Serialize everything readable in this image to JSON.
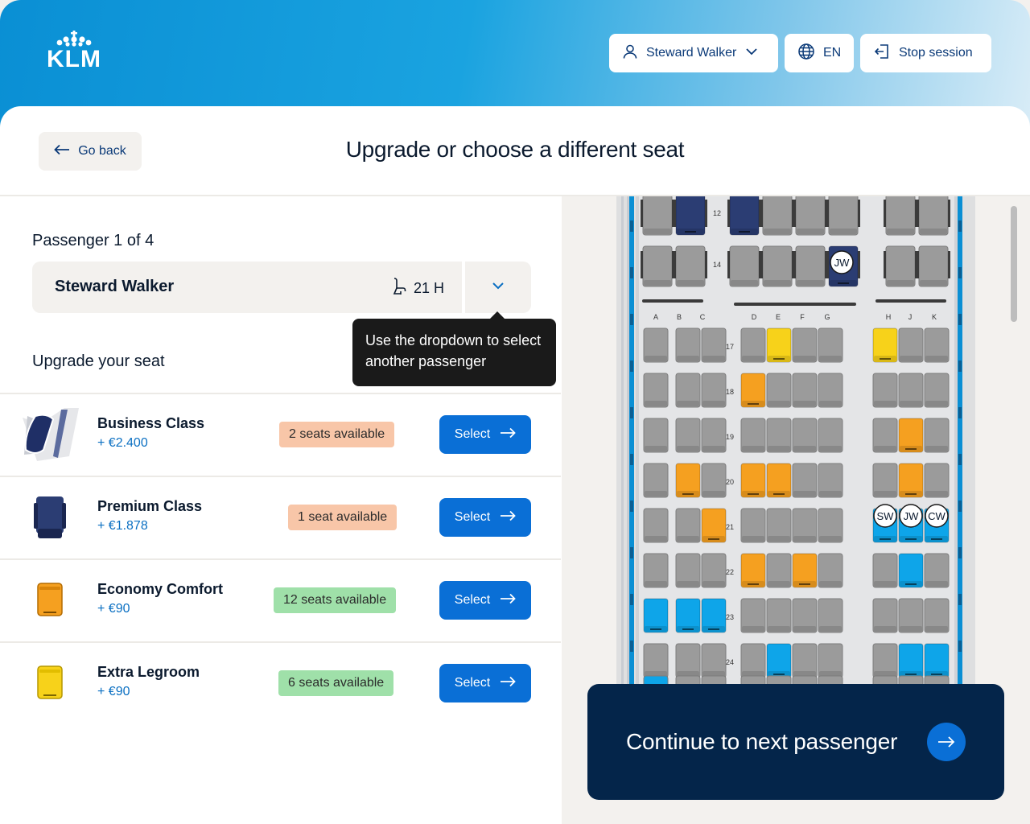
{
  "header": {
    "logo_text": "KLM",
    "user_label": "Steward Walker",
    "language_label": "EN",
    "stop_label": "Stop session"
  },
  "nav": {
    "go_back_label": "Go back"
  },
  "page": {
    "title": "Upgrade or choose a different seat"
  },
  "passenger": {
    "label": "Passenger  1 of 4",
    "name": "Steward Walker",
    "seat": "21 H",
    "tooltip": "Use the dropdown to select another passenger"
  },
  "upgrade": {
    "heading": "Upgrade your seat",
    "options": [
      {
        "name": "Business Class",
        "price": "+ €2.400",
        "availability": "2 seats available",
        "status": "warn",
        "select_label": "Select",
        "icon": "business-seat-icon"
      },
      {
        "name": "Premium Class",
        "price": "+ €1.878",
        "availability": "1 seat available",
        "status": "warn",
        "select_label": "Select",
        "icon": "premium-seat-icon"
      },
      {
        "name": "Economy Comfort",
        "price": "+ €90",
        "availability": "12 seats available",
        "status": "ok",
        "select_label": "Select",
        "icon": "economy-comfort-seat-icon"
      },
      {
        "name": "Extra Legroom",
        "price": "+ €90",
        "availability": "6 seats available",
        "status": "ok",
        "select_label": "Select",
        "icon": "extra-legroom-seat-icon"
      }
    ]
  },
  "seatmap": {
    "colors": {
      "available": "#0ea5e9",
      "standard": "#9b9b9b",
      "comfort": "#f5a020",
      "legroom": "#f7d21a",
      "premium": "#2b3d73",
      "frame": "#0a8fd4"
    },
    "column_letters": [
      "A",
      "B",
      "C",
      "D",
      "E",
      "F",
      "G",
      "H",
      "J",
      "K"
    ],
    "rows": [
      {
        "row": "12",
        "seats": "s,p,-,p,s,s,s,-,s,s"
      },
      {
        "row": "14",
        "seats": "s,s,-,s,s,s,P,-,s,s"
      },
      {
        "row": "17",
        "seats": "s,s,s,s,y,s,s,y,s,s"
      },
      {
        "row": "18",
        "seats": "s,s,s,o,s,s,s,s,s,s"
      },
      {
        "row": "19",
        "seats": "s,s,s,s,s,s,s,s,o,s"
      },
      {
        "row": "20",
        "seats": "s,o,s,o,o,s,s,s,o,s"
      },
      {
        "row": "21",
        "seats": "s,s,o,s,s,s,s,b,b,b"
      },
      {
        "row": "22",
        "seats": "s,s,s,o,s,o,s,s,b,s"
      },
      {
        "row": "23",
        "seats": "b,b,b,s,s,s,s,s,s,s"
      },
      {
        "row": "24",
        "seats": "s,s,s,s,b,s,s,s,b,b"
      }
    ],
    "occupants": [
      {
        "initials": "JW",
        "row": "14",
        "col": "G"
      },
      {
        "initials": "SW",
        "row": "21",
        "col": "H"
      },
      {
        "initials": "JW",
        "row": "21",
        "col": "J"
      },
      {
        "initials": "CW",
        "row": "21",
        "col": "K"
      }
    ]
  },
  "continue": {
    "label": "Continue to next passenger"
  }
}
